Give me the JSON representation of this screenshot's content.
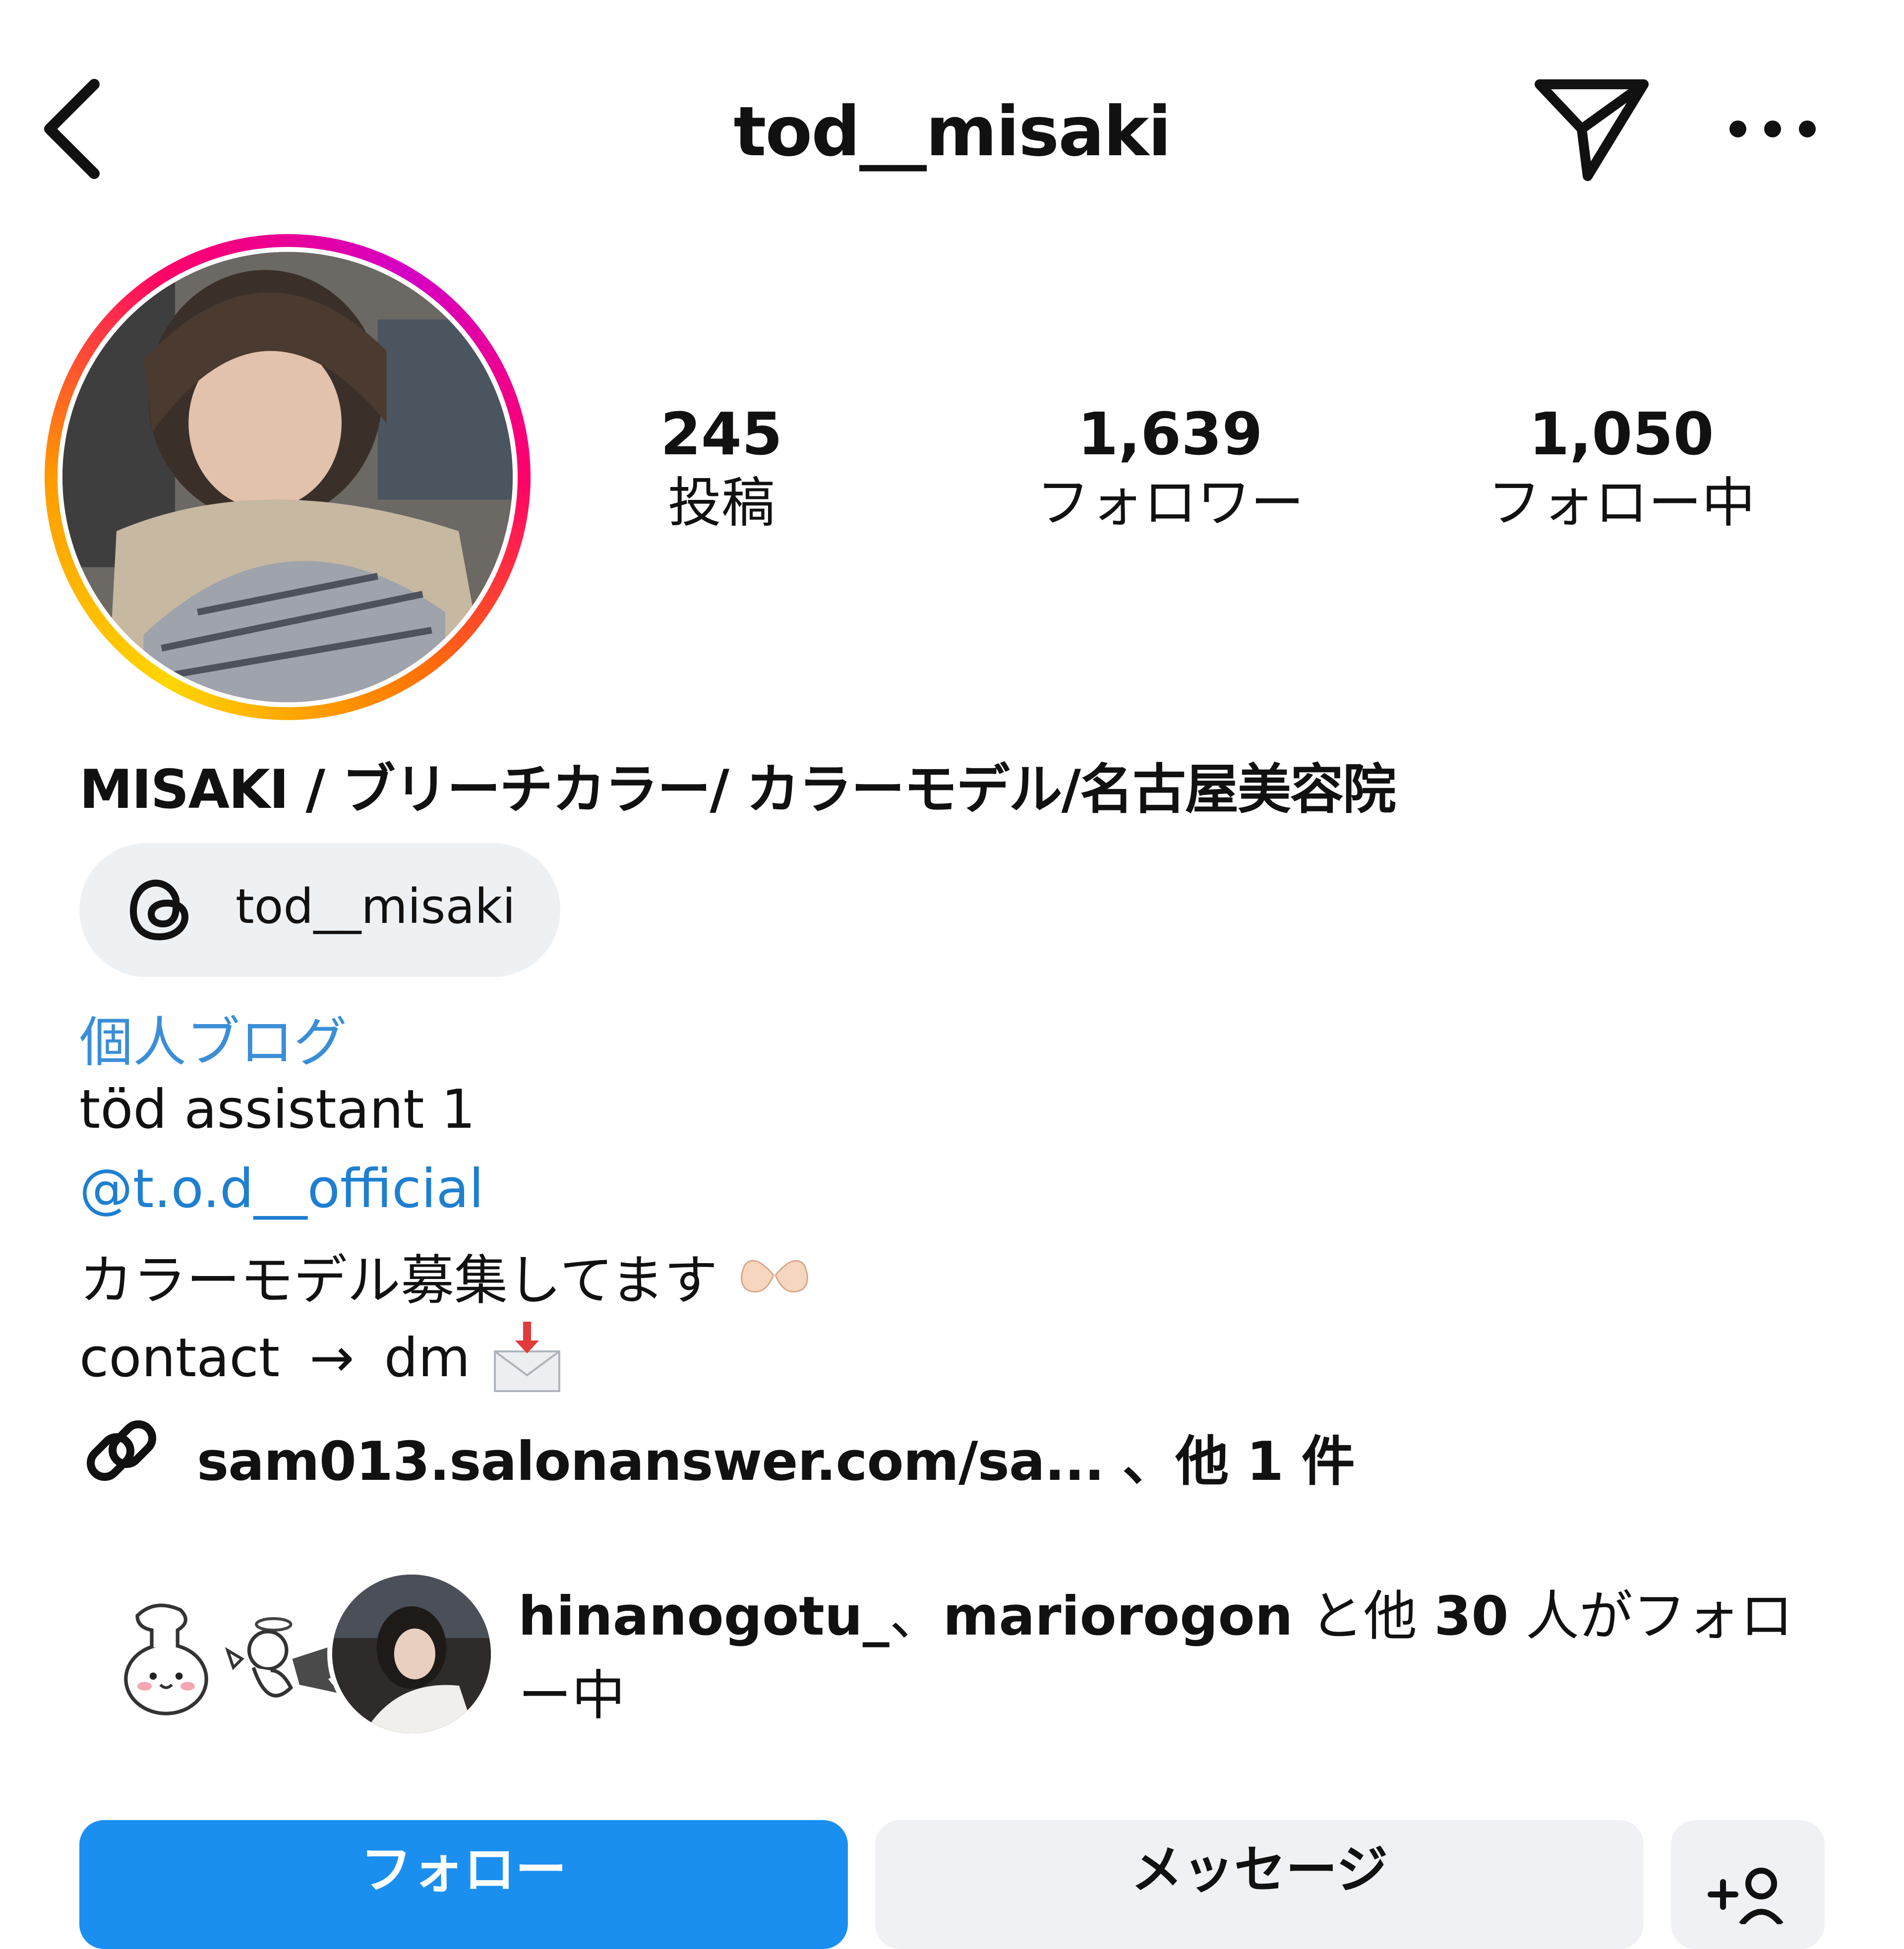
{
  "header": {
    "username": "tod__misaki",
    "back_icon": "chevron-left-icon",
    "send_icon": "paper-plane-icon",
    "more_icon": "ellipsis-icon"
  },
  "stats": {
    "posts": {
      "value": "245",
      "label": "投稿"
    },
    "followers": {
      "value": "1,639",
      "label": "フォロワー"
    },
    "following": {
      "value": "1,050",
      "label": "フォロー中"
    }
  },
  "bio": {
    "display_name": "MISAKI / ブリーチカラー/ カラーモデル/名古屋美容院",
    "threads_handle": "tod__misaki",
    "category": "個人ブログ",
    "line1": "töd assistant 1",
    "mention": "@t.o.d__official",
    "line2": "カラーモデル募集してます",
    "line3_a": "contact",
    "line3_arrow": "→",
    "line3_b": "dm",
    "link_text": "sam013.salonanswer.com/sa... 、他 1 件"
  },
  "followed_by": {
    "user1": "hinanogotu_",
    "separator": "、",
    "user2": "mariorogon",
    "connector": "と他",
    "count": "30",
    "suffix": "人がフォロー中"
  },
  "buttons": {
    "follow": "フォロー",
    "message": "メッセージ",
    "add_icon": "add-person-icon"
  },
  "colors": {
    "accent_blue": "#1b8ff0",
    "link_blue": "#3b8ed6",
    "button_gray": "#eff1f4"
  }
}
